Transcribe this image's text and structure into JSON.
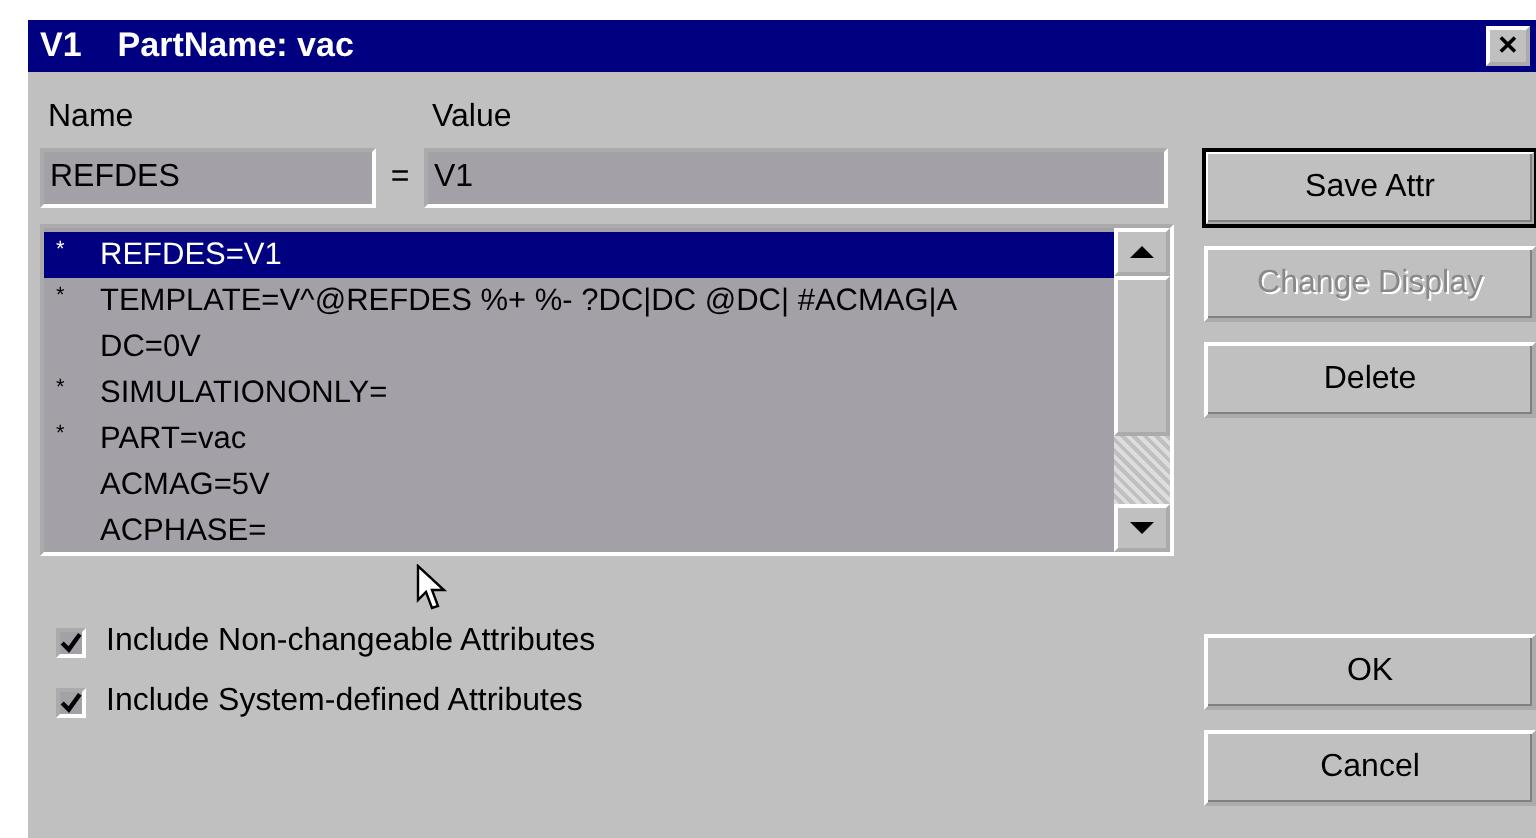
{
  "window": {
    "title_id": "V1",
    "title": "PartName: vac",
    "close": "✕"
  },
  "labels": {
    "name": "Name",
    "value": "Value",
    "equals": "="
  },
  "fields": {
    "name": "REFDES",
    "value": "V1"
  },
  "attributes": [
    {
      "flag": "*",
      "text": "REFDES=V1",
      "selected": true
    },
    {
      "flag": "*",
      "text": "TEMPLATE=V^@REFDES %+ %- ?DC|DC @DC| #ACMAG|A",
      "selected": false
    },
    {
      "text": "DC=0V",
      "selected": false
    },
    {
      "flag": "*",
      "text": "SIMULATIONONLY=",
      "selected": false
    },
    {
      "flag": "*",
      "text": "PART=vac",
      "selected": false
    },
    {
      "text": "ACMAG=5V",
      "selected": false
    },
    {
      "text": "ACPHASE=",
      "selected": false
    }
  ],
  "side_buttons": [
    {
      "label": "Save Attr",
      "disabled": false,
      "default": true
    },
    {
      "label": "Change Display",
      "disabled": true,
      "default": false
    },
    {
      "label": "Delete",
      "disabled": false,
      "default": false
    }
  ],
  "checkboxes": [
    {
      "label": "Include Non-changeable Attributes",
      "checked": true
    },
    {
      "label": "Include System-defined Attributes",
      "checked": true
    }
  ],
  "bottom_buttons": [
    {
      "label": "OK",
      "disabled": false,
      "default": false
    },
    {
      "label": "Cancel",
      "disabled": false,
      "default": false
    }
  ]
}
